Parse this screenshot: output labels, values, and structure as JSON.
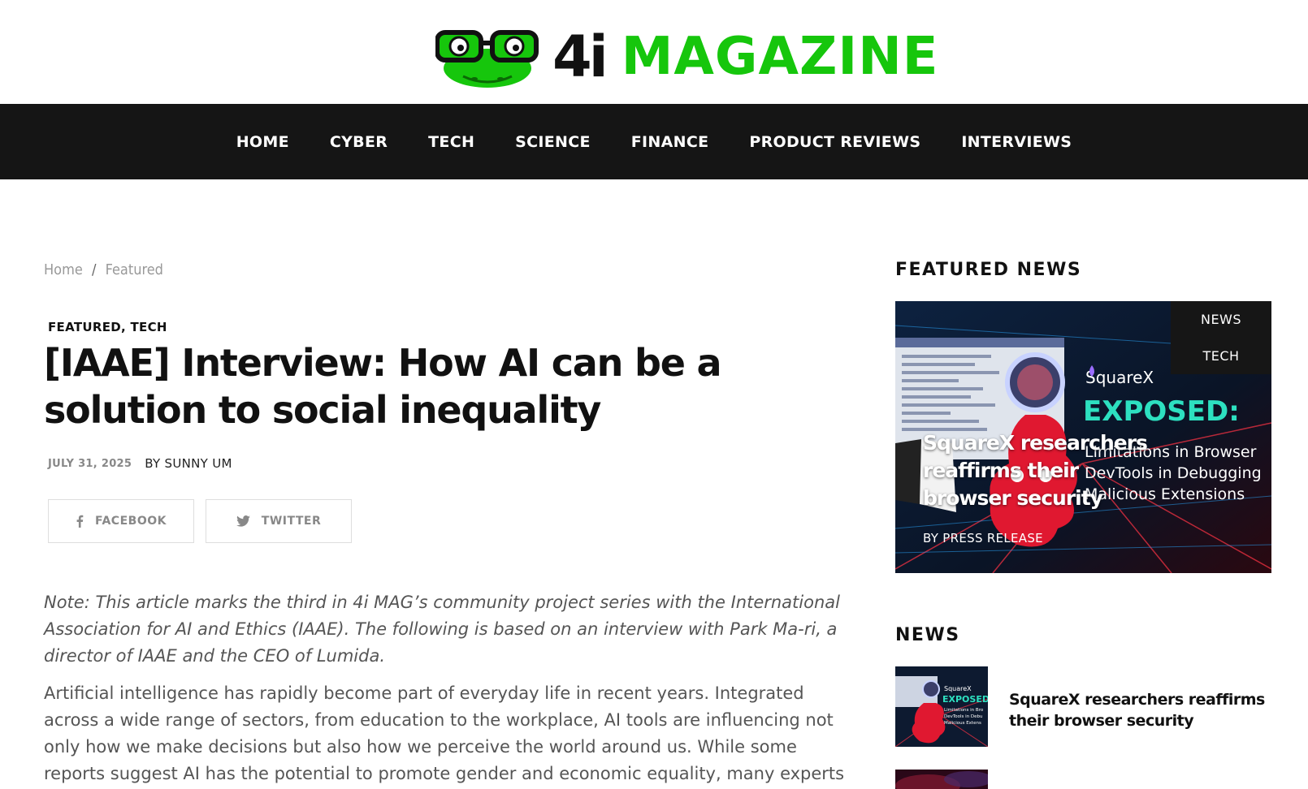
{
  "brand": {
    "logo_number": "4i",
    "logo_word": "MAGAZINE",
    "accent_color": "#16c60c"
  },
  "nav": {
    "items": [
      {
        "label": "HOME"
      },
      {
        "label": "CYBER"
      },
      {
        "label": "TECH"
      },
      {
        "label": "SCIENCE"
      },
      {
        "label": "FINANCE"
      },
      {
        "label": "PRODUCT REVIEWS"
      },
      {
        "label": "INTERVIEWS"
      }
    ]
  },
  "breadcrumb": {
    "home": "Home",
    "separator": "/",
    "current": "Featured"
  },
  "article": {
    "categories": "FEATURED, TECH",
    "title": "[IAAE] Interview: How AI can be a solution to social inequality",
    "date": "JULY 31, 2025",
    "author": "BY SUNNY UM",
    "share_facebook": "FACEBOOK",
    "share_twitter": "TWITTER",
    "note": "Note: This article marks the third in 4i MAG’s community project series with the International Association for AI and Ethics (IAAE). The following is based on an interview with Park Ma-ri, a director of IAAE and the CEO of Lumida.",
    "body": "Artificial intelligence has rapidly become part of everyday life in recent years. Integrated across a wide range of sectors, from education to the workplace, AI tools are influencing not only how we make decisions but also how we perceive the world around us. While some reports suggest AI has the potential to promote gender and economic equality, many experts are increasingly optimistic"
  },
  "sidebar": {
    "featured_title": "FEATURED NEWS",
    "featured_card": {
      "tags": [
        "NEWS",
        "TECH"
      ],
      "title": "SquareX researchers reaffirms their browser security",
      "byline": "BY PRESS RELEASE",
      "image_brand": "SquareX",
      "image_headline": "EXPOSED:",
      "image_subtext": [
        "Limitations in Browser",
        "DevTools in Debugging",
        "Malicious Extensions"
      ]
    },
    "news_title": "NEWS",
    "news_items": [
      {
        "title": "SquareX researchers reaffirms their browser security",
        "thumb_brand": "SquareX",
        "thumb_headline": "EXPOSED",
        "thumb_subtext": [
          "Limitations in Bro",
          "DevTools in Debu",
          "Malicious Extens"
        ]
      }
    ]
  }
}
